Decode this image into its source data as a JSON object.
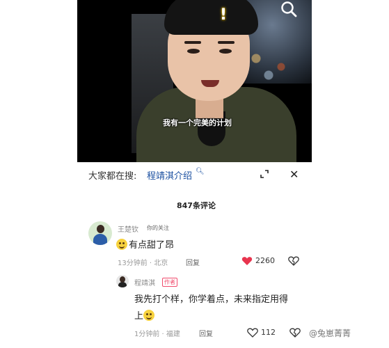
{
  "video": {
    "subtitle": "我有一个完美的计划"
  },
  "search_bar": {
    "label": "大家都在搜:",
    "term": "程靖淇介绍"
  },
  "comments_header": {
    "count_text": "847条评论"
  },
  "comment1": {
    "username": "王楚钦",
    "tag": "你的关注",
    "text": "有点甜了昂",
    "time_location": "13分钟前 · 北京",
    "reply_label": "回复",
    "likes": "2260"
  },
  "comment2": {
    "username": "程靖淇",
    "author_tag": "作者",
    "text_line1": "我先打个样，你学着点，未来指定用得",
    "text_line2": "上",
    "time_location": "1分钟前 · 福建",
    "reply_label": "回复",
    "likes": "112"
  },
  "watermark": "@兔崽菁菁",
  "colors": {
    "liked_heart": "#e8344e",
    "author_tag": "#f04a6b",
    "search_term": "#1a4fa0"
  }
}
